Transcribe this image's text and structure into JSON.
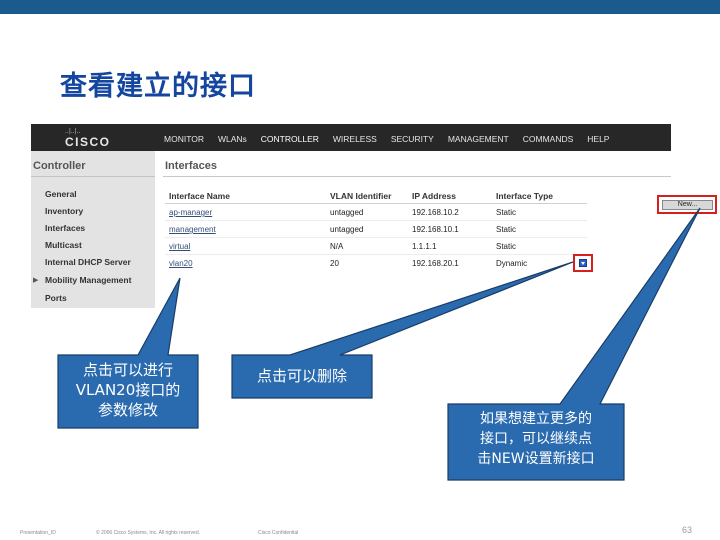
{
  "slide": {
    "title": "查看建立的接口",
    "page_number": "63",
    "footer_left": "Presentation_ID",
    "footer_copyright": "© 2006 Cisco Systems, Inc. All rights reserved.",
    "footer_confidential": "Cisco Confidential",
    "accent_color": "#1446a0",
    "callout_color": "#2a6bb0"
  },
  "app": {
    "logo_text": "CISCO",
    "logo_bars": "..|..|..",
    "nav": [
      "MONITOR",
      "WLANs",
      "CONTROLLER",
      "WIRELESS",
      "SECURITY",
      "MANAGEMENT",
      "COMMANDS",
      "HELP"
    ],
    "active_nav": "CONTROLLER"
  },
  "sidebar": {
    "title": "Controller",
    "items": [
      {
        "label": "General"
      },
      {
        "label": "Inventory"
      },
      {
        "label": "Interfaces"
      },
      {
        "label": "Multicast"
      },
      {
        "label": "Internal DHCP Server"
      },
      {
        "label": "Mobility Management"
      },
      {
        "label": "Ports"
      }
    ]
  },
  "content": {
    "title": "Interfaces",
    "new_button": "New...",
    "columns": [
      "Interface Name",
      "VLAN Identifier",
      "IP Address",
      "Interface Type"
    ],
    "rows": [
      {
        "name": "ap-manager",
        "vlan": "untagged",
        "ip": "192.168.10.2",
        "type": "Static"
      },
      {
        "name": "management",
        "vlan": "untagged",
        "ip": "192.168.10.1",
        "type": "Static"
      },
      {
        "name": "virtual",
        "vlan": "N/A",
        "ip": "1.1.1.1",
        "type": "Static"
      },
      {
        "name": "vlan20",
        "vlan": "20",
        "ip": "192.168.20.1",
        "type": "Dynamic"
      }
    ]
  },
  "callouts": {
    "edit": "点击可以进行\nVLAN20接口的\n参数修改",
    "delete": "点击可以删除",
    "new": "如果想建立更多的\n接口，可以继续点\n击NEW设置新接口"
  }
}
